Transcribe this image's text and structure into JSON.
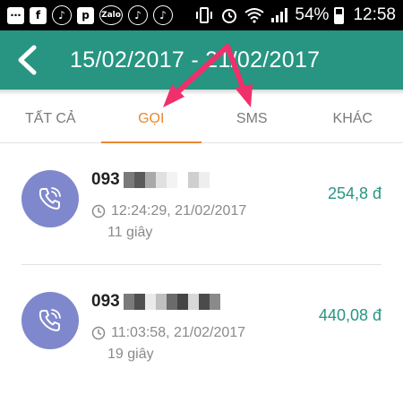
{
  "status_bar": {
    "icons": [
      "more-icon",
      "facebook-icon",
      "music-icon",
      "p-app-icon",
      "zalo-icon",
      "music-icon",
      "music-icon",
      "vibrate-icon",
      "alarm-icon",
      "wifi-icon",
      "signal-icon"
    ],
    "zalo_label": "Zalo",
    "battery": "54%",
    "time": "12:58"
  },
  "header": {
    "title": "15/02/2017 - 21/02/2017",
    "color": "#279582"
  },
  "tabs": [
    {
      "label": "TẤT CẢ",
      "active": false
    },
    {
      "label": "GỌI",
      "active": true
    },
    {
      "label": "SMS",
      "active": false
    },
    {
      "label": "KHÁC",
      "active": false
    }
  ],
  "calls": [
    {
      "number": "093",
      "time": "12:24:29, 21/02/2017",
      "duration": "11 giây",
      "amount": "254,8 đ"
    },
    {
      "number": "093",
      "time": "11:03:58, 21/02/2017",
      "duration": "19 giây",
      "amount": "440,08 đ"
    }
  ],
  "colors": {
    "accent": "#e8882f",
    "avatar": "#7f88cc",
    "amount": "#279582",
    "annotation": "#f0306b"
  }
}
